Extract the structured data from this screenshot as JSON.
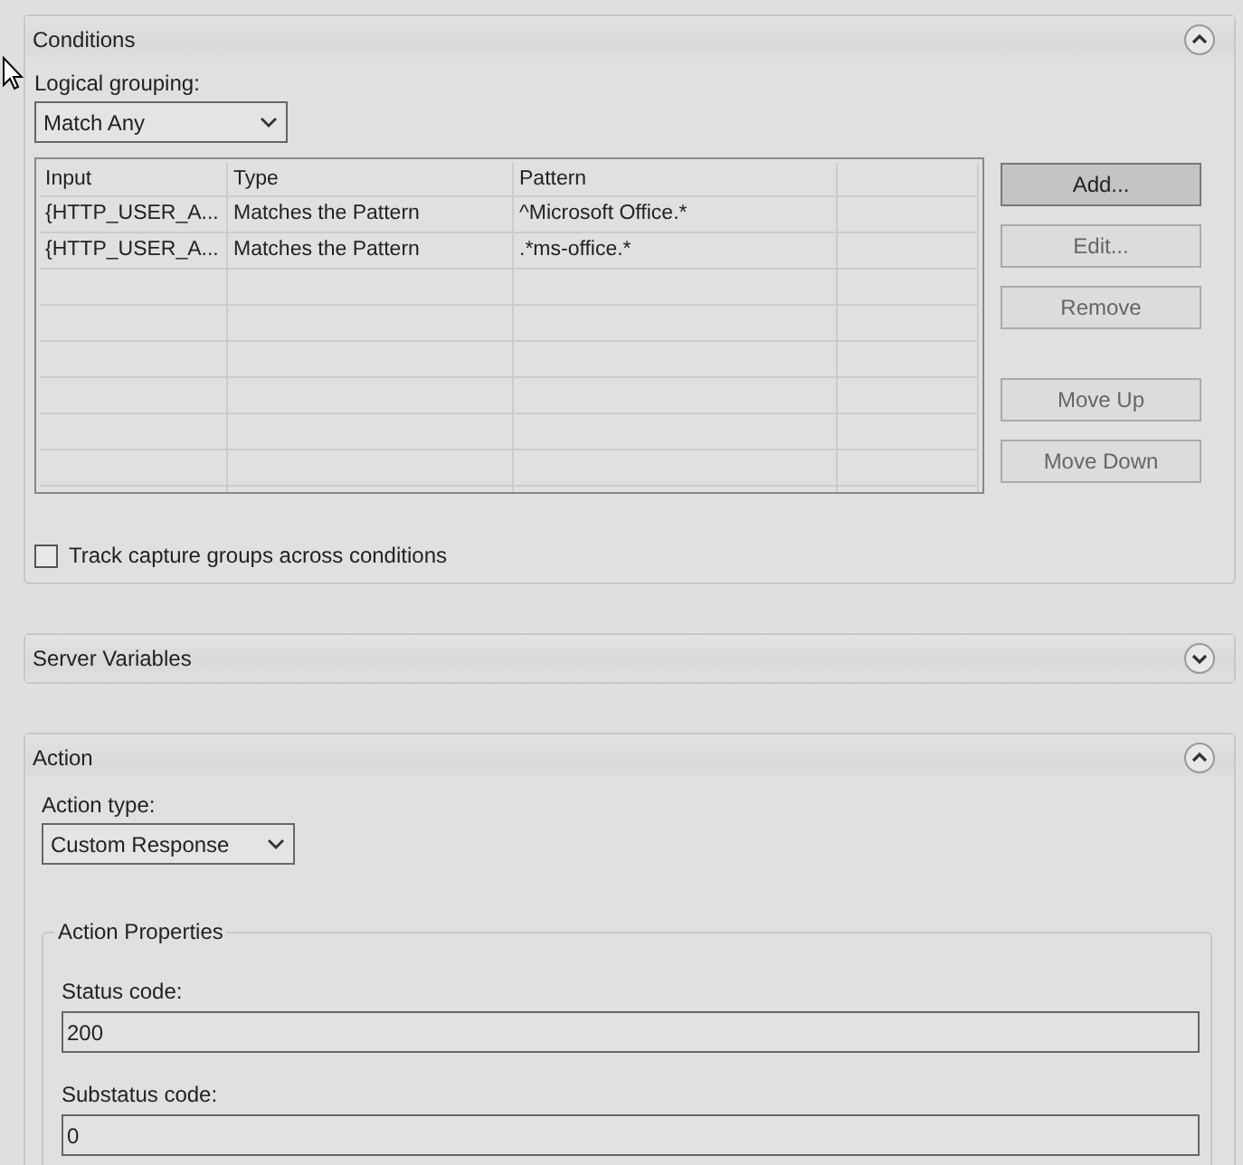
{
  "conditions": {
    "title": "Conditions",
    "expanded": true,
    "grouping_label": "Logical grouping:",
    "grouping_value": "Match Any",
    "table": {
      "columns": [
        "Input",
        "Type",
        "Pattern"
      ],
      "rows": [
        {
          "cells": [
            "{HTTP_USER_A...",
            "Matches the Pattern",
            "^Microsoft Office.*"
          ]
        },
        {
          "cells": [
            "{HTTP_USER_A...",
            "Matches the Pattern",
            ".*ms-office.*"
          ]
        }
      ]
    },
    "button_groups": [
      [
        {
          "label": "Add...",
          "disabled": false
        },
        {
          "label": "Edit...",
          "disabled": true
        },
        {
          "label": "Remove",
          "disabled": true
        }
      ],
      [
        {
          "label": "Move Up",
          "disabled": true
        },
        {
          "label": "Move Down",
          "disabled": true
        }
      ]
    ],
    "track_capture": {
      "label": "Track capture groups across conditions",
      "checked": false
    }
  },
  "server_variables": {
    "title": "Server Variables",
    "expanded": false
  },
  "action": {
    "title": "Action",
    "expanded": true,
    "type_label": "Action type:",
    "type_value": "Custom Response",
    "properties": {
      "legend": "Action Properties",
      "fields": [
        {
          "label": "Status code:",
          "value": "200"
        },
        {
          "label": "Substatus code:",
          "value": "0"
        }
      ]
    }
  }
}
